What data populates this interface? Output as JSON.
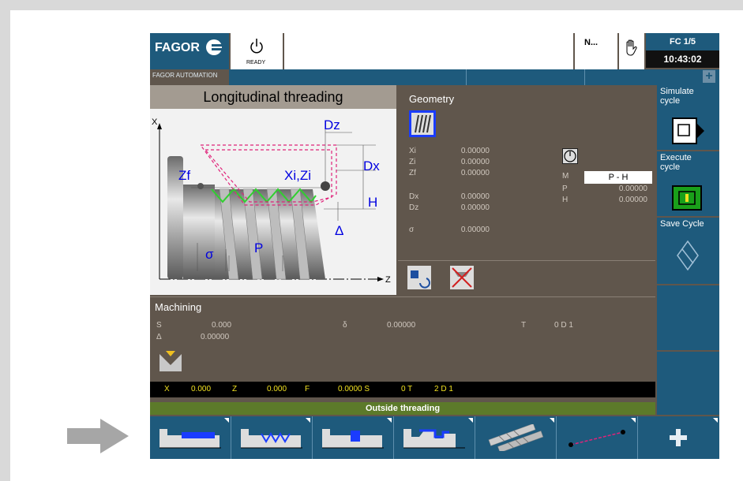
{
  "header": {
    "brand": "FAGOR",
    "brand_sub": "FAGOR AUTOMATION",
    "ready_label": "READY",
    "n_label": "N...",
    "fc_label": "FC 1/5",
    "clock": "10:43:02"
  },
  "panel_title": "Longitudinal threading",
  "diagram": {
    "axis_x": "X",
    "axis_z": "Z",
    "label_dz": "Dz",
    "label_dx": "Dx",
    "label_zf": "Zf",
    "label_xizi": "Xi,Zi",
    "label_h": "H",
    "label_delta": "Δ",
    "label_sigma": "σ",
    "label_p": "P"
  },
  "geometry": {
    "title": "Geometry",
    "rows": [
      {
        "key": "Xi",
        "value": "0.00000"
      },
      {
        "key": "Zi",
        "value": "0.00000"
      },
      {
        "key": "Zf",
        "value": "0.00000"
      },
      {
        "key": "Dx",
        "value": "0.00000"
      },
      {
        "key": "Dz",
        "value": "0.00000"
      },
      {
        "key": "σ",
        "value": "0.00000"
      }
    ],
    "m_label": "M",
    "m_value": "P - H",
    "p_label": "P",
    "p_value": "0.00000",
    "h_label": "H",
    "h_value": "0.00000"
  },
  "machining": {
    "title": "Machining",
    "s_label": "S",
    "s_value": "0.000",
    "delta_label": "Δ",
    "delta_value": "0.00000",
    "small_delta_label": "δ",
    "small_delta_value": "0.00000",
    "t_label": "T",
    "t_value": "0 D  1"
  },
  "status_bar": {
    "x_label": "X",
    "x_value": "0.000",
    "z_label": "Z",
    "z_value": "0.000",
    "f_label": "F",
    "f_value": "0.0000 S",
    "t_value": "0 T",
    "d_value": "2 D 1"
  },
  "mode_bar": "Outside threading",
  "right_softkeys": [
    {
      "label": "Simulate cycle"
    },
    {
      "label": "Execute cycle"
    },
    {
      "label": "Save Cycle"
    }
  ],
  "bottom_softkeys": [
    {
      "icon": "turning-cycle-icon"
    },
    {
      "icon": "threading-cycle-icon"
    },
    {
      "icon": "grooving-cycle-icon"
    },
    {
      "icon": "profile-cycle-icon"
    },
    {
      "icon": "drilling-tools-icon"
    },
    {
      "icon": "profile-points-icon"
    },
    {
      "icon": "plus-icon"
    }
  ],
  "colors": {
    "panel_bg": "#60564c",
    "softkey_bg": "#1e5a7c",
    "status_text": "#f0e020",
    "mode_bar_bg": "#5c7a2a",
    "thread_green": "#2fd02f",
    "path_magenta": "#e0237a"
  }
}
